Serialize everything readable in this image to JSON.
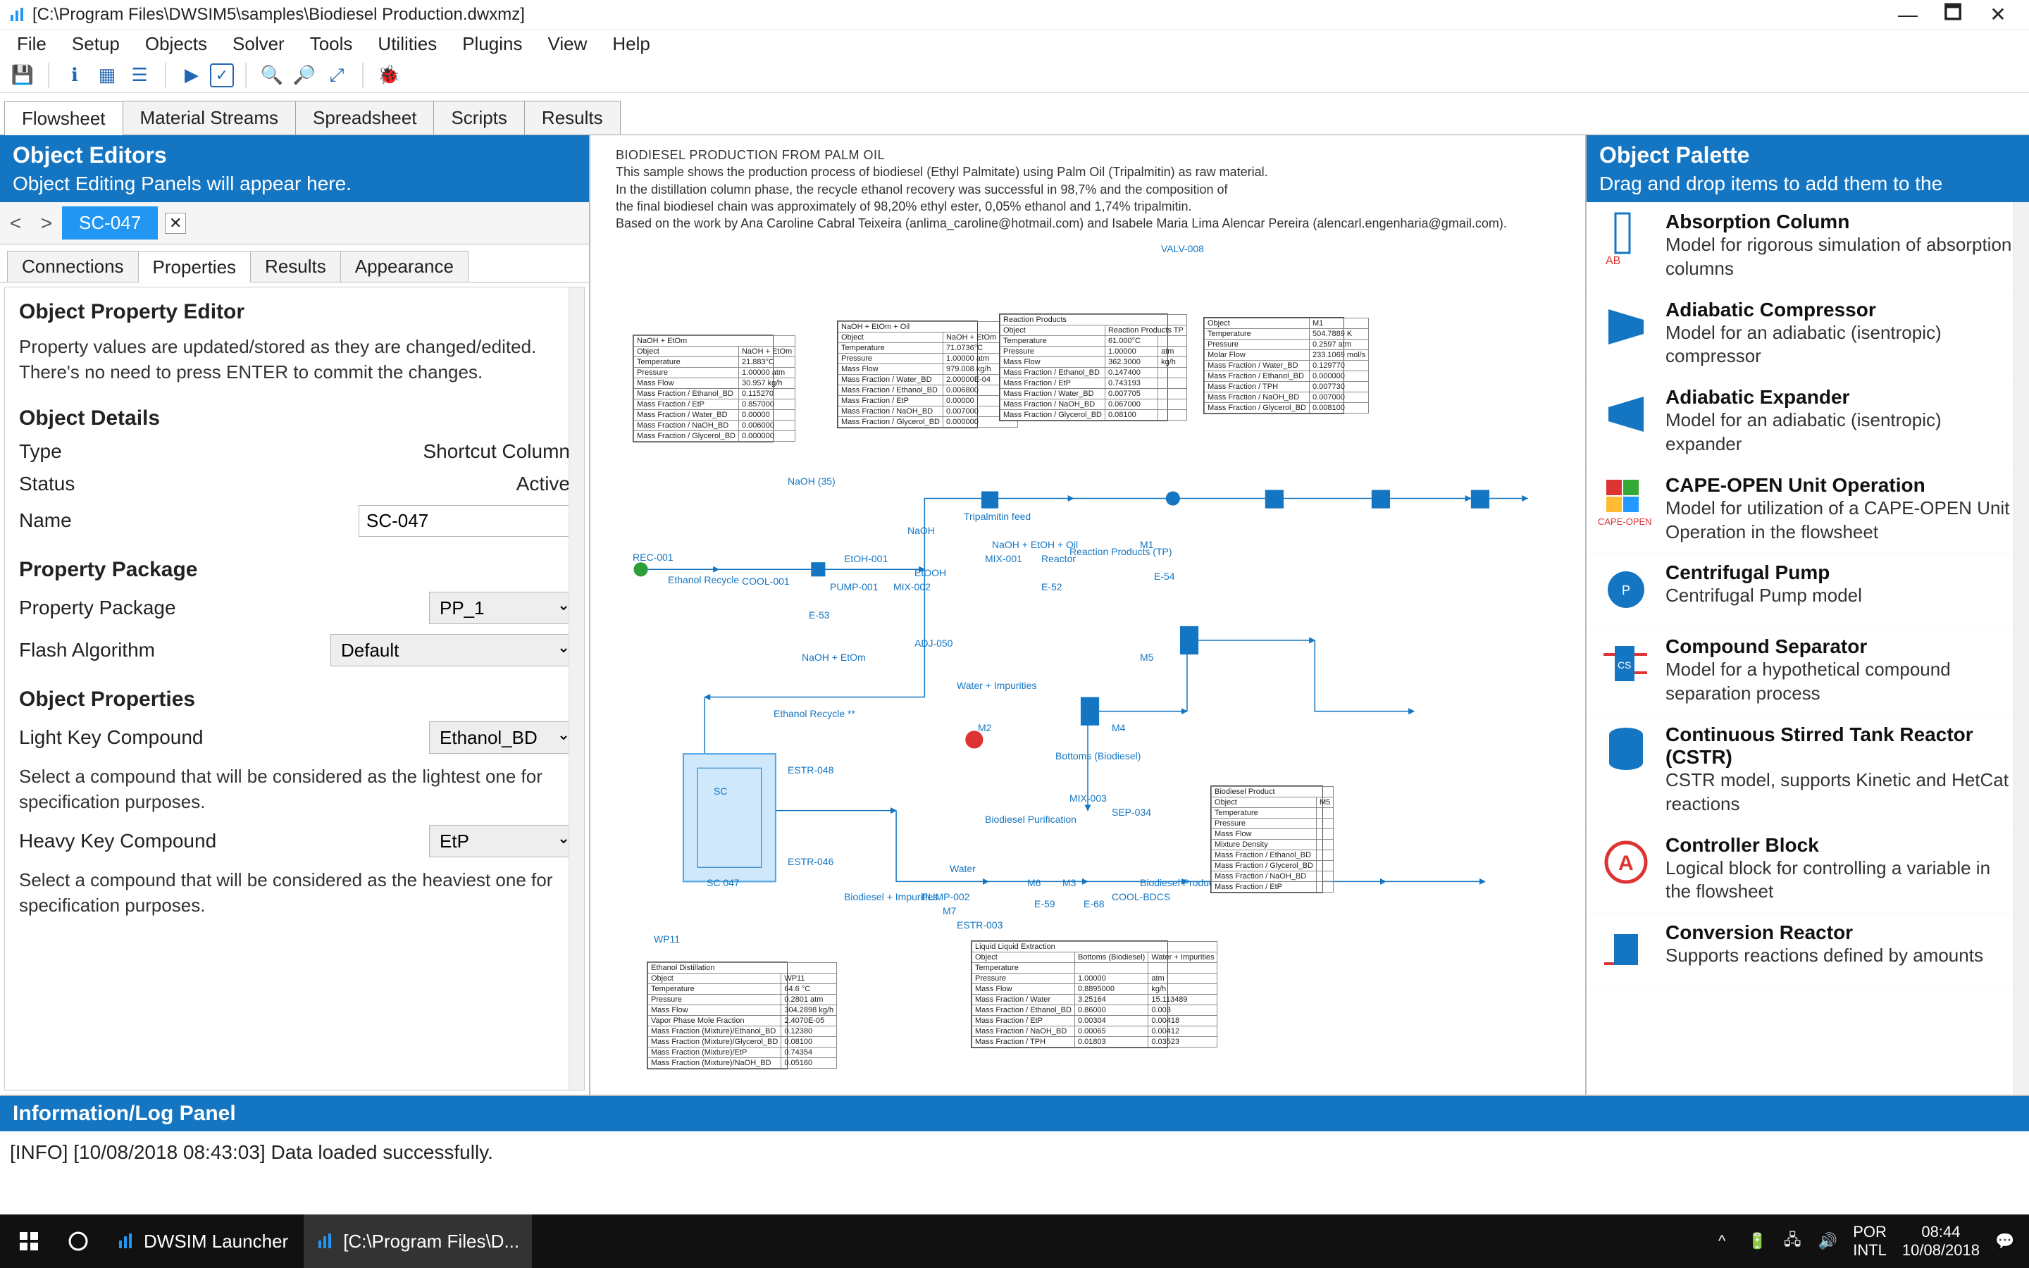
{
  "window": {
    "title": "[C:\\Program Files\\DWSIM5\\samples\\Biodiesel Production.dwxmz]"
  },
  "menu": [
    "File",
    "Setup",
    "Objects",
    "Solver",
    "Tools",
    "Utilities",
    "Plugins",
    "View",
    "Help"
  ],
  "main_tabs": [
    "Flowsheet",
    "Material Streams",
    "Spreadsheet",
    "Scripts",
    "Results"
  ],
  "active_main_tab": 0,
  "left_panel": {
    "title": "Object Editors",
    "subtitle": "Object Editing Panels will appear here.",
    "obj_tab": "SC-047",
    "sub_tabs": [
      "Connections",
      "Properties",
      "Results",
      "Appearance"
    ],
    "active_sub_tab": 1,
    "editor_title": "Object Property Editor",
    "editor_desc": "Property values are updated/stored as they are changed/edited. There's no need to press ENTER to commit the changes.",
    "details_title": "Object Details",
    "type_label": "Type",
    "type_value": "Shortcut Column",
    "status_label": "Status",
    "status_value": "Active",
    "name_label": "Name",
    "name_value": "SC-047",
    "pp_title": "Property Package",
    "pp_label": "Property Package",
    "pp_value": "PP_1",
    "flash_label": "Flash Algorithm",
    "flash_value": "Default",
    "props_title": "Object Properties",
    "light_label": "Light Key Compound",
    "light_value": "Ethanol_BD",
    "light_help": "Select a compound that will be considered as the lightest one for specification purposes.",
    "heavy_label": "Heavy Key Compound",
    "heavy_value": "EtP",
    "heavy_help": "Select a compound that will be considered as the heaviest one for specification purposes."
  },
  "flowsheet_desc": {
    "title": "BIODIESEL PRODUCTION FROM PALM OIL",
    "l1": "This sample shows the production process of biodiesel (Ethyl Palmitate) using Palm Oil (Tripalmitin) as raw material.",
    "l2": "In the distillation column phase, the recycle ethanol recovery was successful in 98,7% and the composition of",
    "l3": "the final biodiesel chain was approximately of 98,20% ethyl ester, 0,05% ethanol and 1,74% tripalmitin.",
    "l4": "Based on the work by Ana Caroline Cabral Teixeira (anlima_caroline@hotmail.com) and Isabele Maria Lima Alencar Pereira (alencarl.engenharia@gmail.com)."
  },
  "canvas_labels": {
    "ethanol_recycle": "Ethanol Recycle",
    "cool001": "COOL-001",
    "naoh35": "NaOH (35)",
    "etoh001": "EtOH-001",
    "pump001": "PUMP-001",
    "naoh": "NaOH",
    "mix002": "MIX-002",
    "etooh": "EtOOH",
    "tripal_feed": "Tripalmitin feed",
    "rec001": "REC-001",
    "mix001": "MIX-001",
    "naohEtOH35": "NaOH + EtOH + Oil",
    "reactor": "Reactor",
    "reaction_products": "Reaction Products (TP)",
    "valv008": "VALV-008",
    "m1": "M1",
    "e54": "E-54",
    "e52": "E-52",
    "e53": "E-53",
    "adj050": "ADJ-050",
    "estr048": "ESTR-048",
    "sc047": "SC 047",
    "sc": "SC",
    "ethanol_recycle2": "Ethanol Recycle **",
    "estr046": "ESTR-046",
    "biodiesel_impurities": "Biodiesel + Impurities",
    "pump002": "PUMP-002",
    "water": "Water",
    "m7": "M7",
    "m2": "M2",
    "water_imp": "Water + Impurities",
    "m4": "M4",
    "mix003": "MIX-003",
    "biod_purif": "Biodiesel Purification",
    "sep034": "SEP-034",
    "bottoms": "Bottoms (Biodiesel)",
    "m6": "M6",
    "e59": "E-59",
    "m3": "M3",
    "e68": "E-68",
    "cool_bdcs": "COOL-BDCS",
    "biodiesel_product": "Biodiesel Product",
    "m5": "M5",
    "estr003": "ESTR-003",
    "naohEtOHm": "NaOH + EtOm",
    "naohEtOHoil": "NaOH + EtOm + Oil",
    "wp11": "WP11"
  },
  "palette": {
    "title": "Object Palette",
    "subtitle": "Drag and drop items to add them to the",
    "items": [
      {
        "name": "Absorption Column",
        "desc": "Model for rigorous simulation of absorption columns"
      },
      {
        "name": "Adiabatic Compressor",
        "desc": "Model for an adiabatic (isentropic) compressor"
      },
      {
        "name": "Adiabatic Expander",
        "desc": "Model for an adiabatic (isentropic) expander"
      },
      {
        "name": "CAPE-OPEN Unit Operation",
        "desc": "Model for utilization of a CAPE-OPEN Unit Operation in the flowsheet"
      },
      {
        "name": "Centrifugal Pump",
        "desc": "Centrifugal Pump model"
      },
      {
        "name": "Compound Separator",
        "desc": "Model for a hypothetical compound separation process"
      },
      {
        "name": "Continuous Stirred Tank Reactor (CSTR)",
        "desc": "CSTR model, supports Kinetic and HetCat reactions"
      },
      {
        "name": "Controller Block",
        "desc": "Logical block for controlling a variable in the flowsheet"
      },
      {
        "name": "Conversion Reactor",
        "desc": "Supports reactions defined by amounts"
      }
    ]
  },
  "log": {
    "title": "Information/Log Panel",
    "line": "[INFO] [10/08/2018 08:43:03] Data loaded successfully."
  },
  "taskbar": {
    "app1": "DWSIM Launcher",
    "app2": "[C:\\Program Files\\D...",
    "lang": "POR",
    "kbd": "INTL",
    "time": "08:44",
    "date": "10/08/2018"
  }
}
